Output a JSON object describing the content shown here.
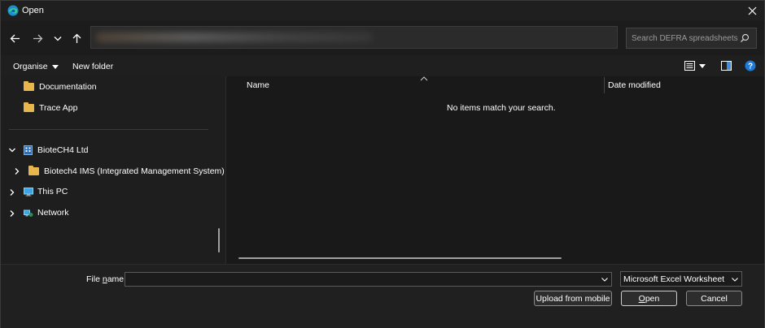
{
  "window": {
    "title": "Open"
  },
  "navigation": {
    "search_placeholder": "Search DEFRA spreadsheets"
  },
  "toolbar": {
    "organise_label": "Organise",
    "new_folder_label": "New folder"
  },
  "sidebar": {
    "items": [
      {
        "label": "Documentation"
      },
      {
        "label": "Trace App"
      },
      {
        "label": "BioteCH4 Ltd"
      },
      {
        "label": "Biotech4 IMS (Integrated Management System) - "
      },
      {
        "label": "This PC"
      },
      {
        "label": "Network"
      }
    ]
  },
  "file_list": {
    "columns": [
      "Name",
      "Date modified"
    ],
    "empty_message": "No items match your search."
  },
  "footer": {
    "file_name_label_pre": "File ",
    "file_name_label_underlined": "n",
    "file_name_label_post": "ame:",
    "file_name_value": "",
    "file_type": "Microsoft Excel Worksheet",
    "upload_label": "Upload from mobile",
    "open_label_underlined": "O",
    "open_label_rest": "pen",
    "cancel_label": "Cancel"
  },
  "colors": {
    "background": "#202020",
    "folder": "#e8b64a",
    "help_icon": "#1e7ad6"
  }
}
